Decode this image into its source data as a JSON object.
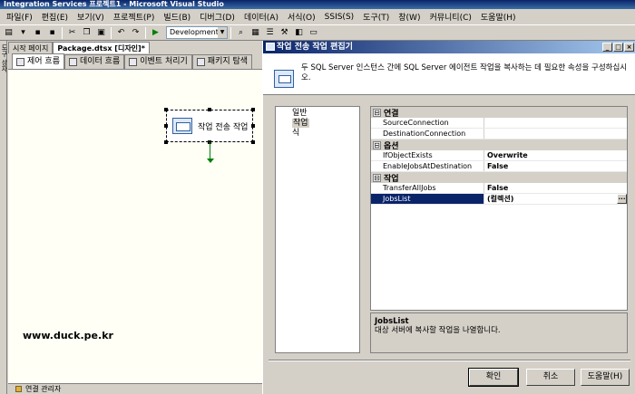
{
  "app": {
    "title": "Integration Services 프로젝트1 - Microsoft Visual Studio"
  },
  "menu": {
    "items": [
      "파일(F)",
      "편집(E)",
      "보기(V)",
      "프로젝트(P)",
      "빌드(B)",
      "디버그(D)",
      "데이터(A)",
      "서식(O)",
      "SSIS(S)",
      "도구(T)",
      "창(W)",
      "커뮤니티(C)",
      "도움말(H)"
    ]
  },
  "toolbar": {
    "configuration": "Development"
  },
  "left_strip": {
    "label": "도구 상자"
  },
  "document": {
    "tabs": [
      "시작 페이지",
      "Package.dtsx [디자인]*"
    ],
    "designer_tabs": [
      "제어 흐름",
      "데이터 흐름",
      "이벤트 처리기",
      "패키지 탐색"
    ],
    "task_label": "작업 전송 작업",
    "watermark": "www.duck.pe.kr",
    "bottom_label": "연결 관리자"
  },
  "dialog": {
    "title": "작업 전송 작업 편집기",
    "header_text": "두 SQL Server 인스턴스 간에 SQL Server 에이전트 작업을 복사하는 데 필요한 속성을 구성하십시오.",
    "nav_items": [
      {
        "label": "일반",
        "selected": false
      },
      {
        "label": "작업",
        "selected": true
      },
      {
        "label": "식",
        "selected": false
      }
    ],
    "categories": [
      {
        "name": "연결",
        "toggle": "⊟",
        "rows": [
          {
            "name": "SourceConnection",
            "value": "",
            "selected": false
          },
          {
            "name": "DestinationConnection",
            "value": "",
            "selected": false
          }
        ]
      },
      {
        "name": "옵션",
        "toggle": "⊟",
        "rows": [
          {
            "name": "IfObjectExists",
            "value": "Overwrite",
            "selected": false
          },
          {
            "name": "EnableJobsAtDestination",
            "value": "False",
            "selected": false
          }
        ]
      },
      {
        "name": "작업",
        "toggle": "⊟",
        "rows": [
          {
            "name": "TransferAllJobs",
            "value": "False",
            "selected": false
          },
          {
            "name": "JobsList",
            "value": "(컬렉션)",
            "selected": true
          }
        ]
      }
    ],
    "description": {
      "title": "JobsList",
      "text": "대상 서버에 복사할 작업을 나열합니다."
    },
    "buttons": {
      "ok": "확인",
      "cancel": "취소",
      "help": "도움말(H)"
    },
    "window_buttons": {
      "minimize": "_",
      "maximize": "□",
      "close": "×"
    }
  }
}
